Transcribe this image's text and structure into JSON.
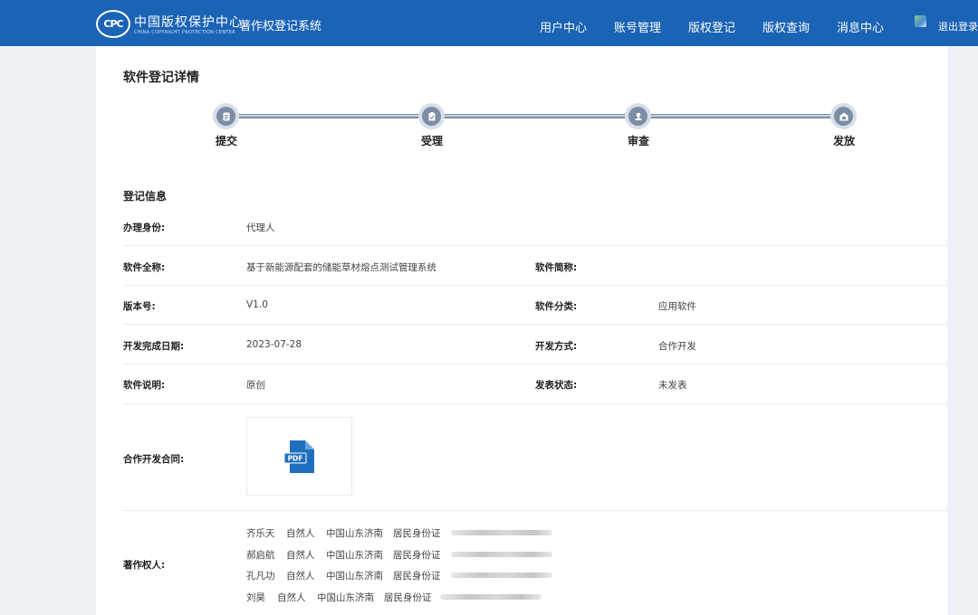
{
  "header": {
    "logo_cn": "中国版权保护中心",
    "logo_en": "CHINA COPYRIGHT PROTECTION CENTER",
    "logo_mark": "CPC",
    "system_name": "著作权登记系统",
    "nav": [
      "用户中心",
      "账号管理",
      "版权登记",
      "版权查询",
      "消息中心"
    ],
    "logout": "退出登录"
  },
  "page": {
    "title": "软件登记详情"
  },
  "steps": [
    {
      "label": "提交",
      "icon": "document-icon"
    },
    {
      "label": "受理",
      "icon": "clipboard-check-icon"
    },
    {
      "label": "审查",
      "icon": "stamp-icon"
    },
    {
      "label": "发放",
      "icon": "certificate-icon"
    }
  ],
  "section": {
    "title": "登记信息"
  },
  "fields": {
    "identity": {
      "label": "办理身份:",
      "value": "代理人"
    },
    "full_name": {
      "label": "软件全称:",
      "value": "基于新能源配套的储能草材熔点测试管理系统"
    },
    "short_name": {
      "label": "软件简称:",
      "value": ""
    },
    "version": {
      "label": "版本号:",
      "value": "V1.0"
    },
    "category": {
      "label": "软件分类:",
      "value": "应用软件"
    },
    "completion_date": {
      "label": "开发完成日期:",
      "value": "2023-07-28"
    },
    "dev_mode": {
      "label": "开发方式:",
      "value": "合作开发"
    },
    "description": {
      "label": "软件说明:",
      "value": "原创"
    },
    "publish_status": {
      "label": "发表状态:",
      "value": "未发表"
    },
    "contract": {
      "label": "合作开发合同:",
      "file_type": "PDF"
    },
    "owners_label": "著作权人:"
  },
  "owners": [
    {
      "name": "齐乐天",
      "type": "自然人",
      "location": "中国山东济南",
      "id_type": "居民身份证"
    },
    {
      "name": "郝启航",
      "type": "自然人",
      "location": "中国山东济南",
      "id_type": "居民身份证"
    },
    {
      "name": "孔凡功",
      "type": "自然人",
      "location": "中国山东济南",
      "id_type": "居民身份证"
    },
    {
      "name": "刘昊",
      "type": "自然人",
      "location": "中国山东济南",
      "id_type": "居民身份证"
    }
  ],
  "colors": {
    "header_bg": "#1a63b5",
    "step_icon": "#7b8ea6",
    "pdf_icon": "#1f6fbf"
  }
}
